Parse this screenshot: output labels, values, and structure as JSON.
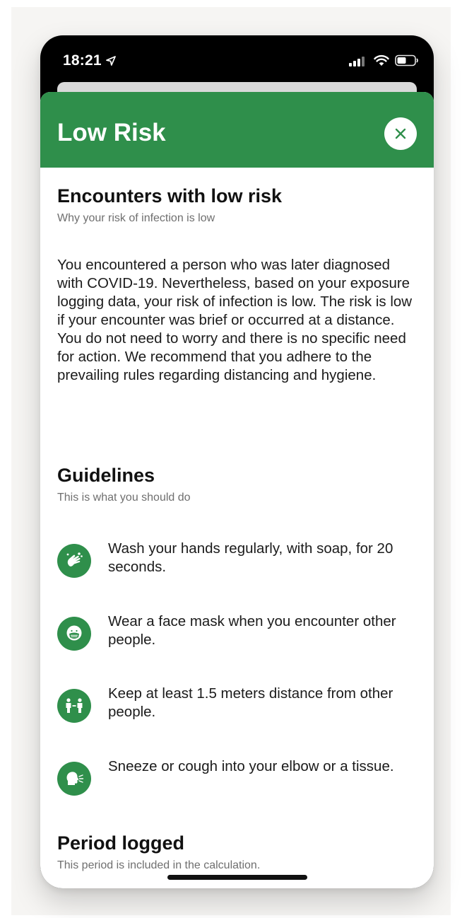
{
  "status_bar": {
    "time": "18:21"
  },
  "sheet": {
    "title": "Low Risk",
    "accent_color": "#2f8f4b"
  },
  "encounters": {
    "title": "Encounters with low risk",
    "subtitle": "Why your risk of infection is low",
    "body": "You encountered a person who was later diagnosed with COVID-19. Nevertheless, based on your exposure logging data, your risk of infection is low. The risk is low if your encounter was brief or occurred at a distance. You do not need to worry and there is no specific need for action. We recommend that you adhere to the prevailing rules regarding distancing and hygiene."
  },
  "guidelines": {
    "title": "Guidelines",
    "subtitle": "This is what you should do",
    "items": [
      {
        "icon": "hand-wash-icon",
        "text": "Wash your hands regularly, with soap, for 20 seconds."
      },
      {
        "icon": "face-mask-icon",
        "text": "Wear a face mask when you encounter other people."
      },
      {
        "icon": "distance-icon",
        "text": "Keep at least 1.5 meters distance from other people."
      },
      {
        "icon": "sneeze-icon",
        "text": "Sneeze or cough into your elbow or a tissue."
      }
    ]
  },
  "period": {
    "title": "Period logged",
    "subtitle": "This period is included in the calculation."
  }
}
